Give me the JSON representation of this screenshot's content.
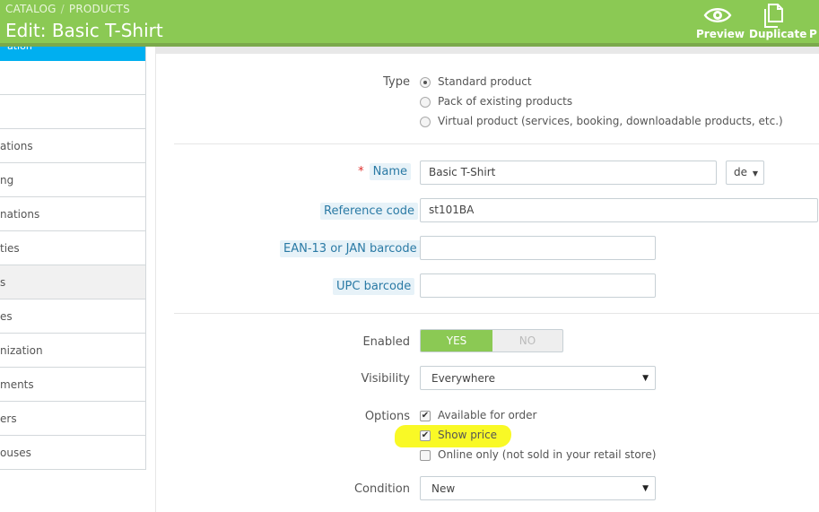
{
  "header": {
    "breadcrumb": [
      "CATALOG",
      "PRODUCTS"
    ],
    "title": "Edit: Basic T-Shirt",
    "toolbar": {
      "preview_label": "Preview",
      "duplicate_label": "Duplicate",
      "more_label": "P"
    }
  },
  "sidebar": {
    "header_label": "ation",
    "items": [
      {
        "label": ""
      },
      {
        "label": ""
      },
      {
        "label": "ations"
      },
      {
        "label": "ng"
      },
      {
        "label": "nations"
      },
      {
        "label": "ties"
      },
      {
        "label": "s"
      },
      {
        "label": "es"
      },
      {
        "label": "nization"
      },
      {
        "label": "ments"
      },
      {
        "label": "ers"
      },
      {
        "label": "ouses"
      }
    ],
    "active_index": 6
  },
  "form": {
    "type": {
      "label": "Type",
      "options": [
        "Standard product",
        "Pack of existing products",
        "Virtual product (services, booking, downloadable products, etc.)"
      ],
      "selected_index": 0
    },
    "name": {
      "label": "Name",
      "required_mark": "*",
      "value": "Basic T-Shirt",
      "language": "de"
    },
    "reference": {
      "label": "Reference code",
      "value": "st101BA"
    },
    "ean13": {
      "label": "EAN-13 or JAN barcode",
      "value": ""
    },
    "upc": {
      "label": "UPC barcode",
      "value": ""
    },
    "enabled": {
      "label": "Enabled",
      "yes_label": "YES",
      "no_label": "NO",
      "value": "YES"
    },
    "visibility": {
      "label": "Visibility",
      "value": "Everywhere"
    },
    "options": {
      "label": "Options",
      "items": [
        {
          "label": "Available for order",
          "checked": true
        },
        {
          "label": "Show price",
          "checked": true
        },
        {
          "label": "Online only (not sold in your retail store)",
          "checked": false
        }
      ]
    },
    "condition": {
      "label": "Condition",
      "value": "New"
    }
  },
  "colors": {
    "header_green": "#8bc954",
    "sidebar_accent": "#00aff0",
    "highlight_yellow": "#f8f800",
    "required_red": "#e0302e"
  }
}
